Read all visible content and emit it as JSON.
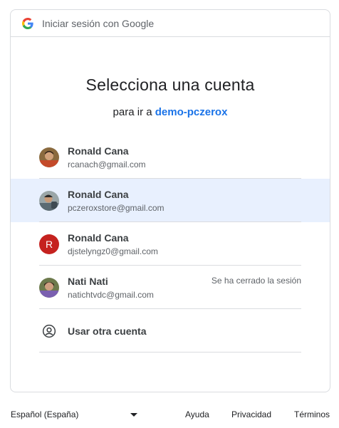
{
  "header": {
    "title": "Iniciar sesión con Google",
    "logo_icon": "google-g-icon"
  },
  "main": {
    "heading": "Selecciona una cuenta",
    "subheading_prefix": "para ir a",
    "app_name": "demo-pczerox"
  },
  "accounts": [
    {
      "name": "Ronald Cana",
      "email": "rcanach@gmail.com",
      "status": "",
      "selected": false
    },
    {
      "name": "Ronald Cana",
      "email": "pczeroxstore@gmail.com",
      "status": "",
      "selected": true
    },
    {
      "name": "Ronald Cana",
      "email": "djstelyngz0@gmail.com",
      "status": "",
      "avatar_letter": "R"
    },
    {
      "name": "Nati Nati",
      "email": "natichtvdc@gmail.com",
      "status": "Se ha cerrado la sesión"
    }
  ],
  "other_account": {
    "label": "Usar otra cuenta",
    "icon": "account-circle-icon"
  },
  "footer": {
    "language": "Español (España)",
    "help": "Ayuda",
    "privacy": "Privacidad",
    "terms": "Términos"
  },
  "colors": {
    "link": "#1a73e8",
    "selected_bg": "#e8f0fe",
    "avatar_letter_bg": "#c5221f"
  }
}
